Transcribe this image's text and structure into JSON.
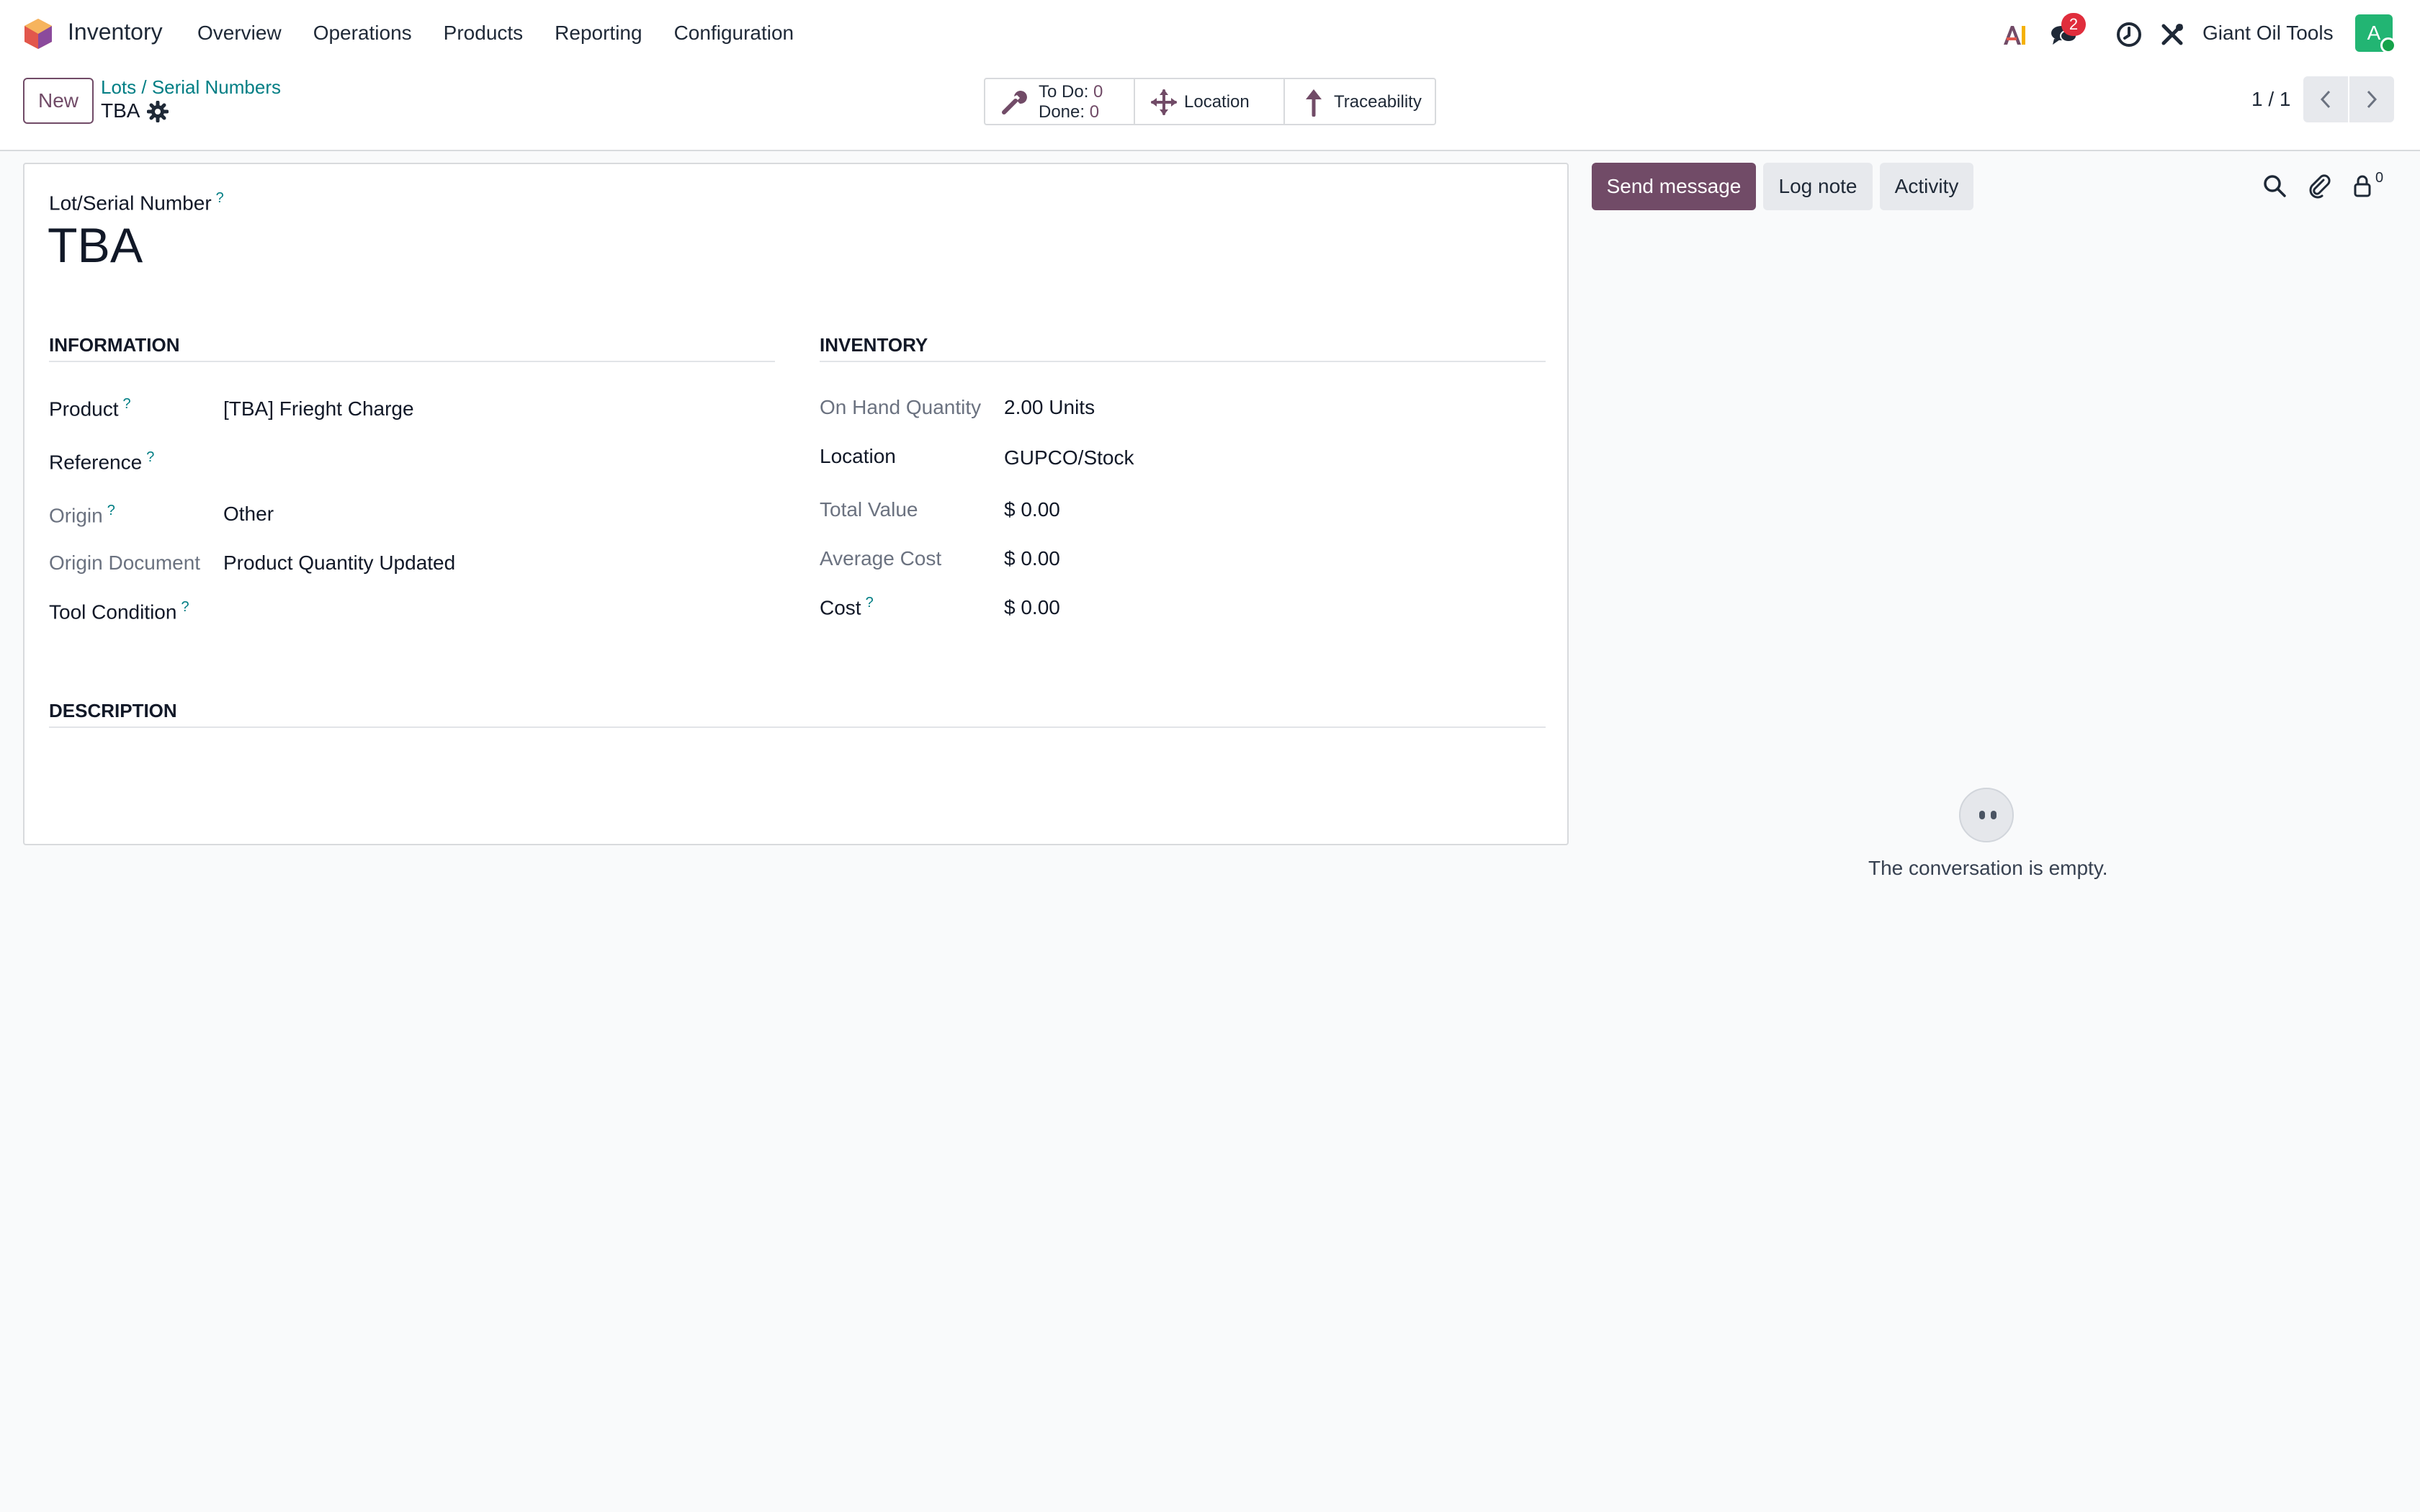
{
  "navbar": {
    "app_name": "Inventory",
    "menu": [
      "Overview",
      "Operations",
      "Products",
      "Reporting",
      "Configuration"
    ],
    "messages_badge": "2",
    "company": "Giant Oil Tools",
    "avatar_initial": "A",
    "icons": [
      "odoo-logo-icon",
      "ai-icon",
      "chat-icon",
      "clock-icon",
      "tools-icon"
    ]
  },
  "control_panel": {
    "new_label": "New",
    "breadcrumb": "Lots / Serial Numbers",
    "record_name": "TBA",
    "smart_buttons": {
      "todo_label": "To Do:",
      "todo_value": "0",
      "done_label": "Done:",
      "done_value": "0",
      "location_label": "Location",
      "traceability_label": "Traceability"
    },
    "pager": "1 / 1"
  },
  "form": {
    "title_label": "Lot/Serial Number",
    "title_value": "TBA",
    "tooltip_mark": "?",
    "information": {
      "heading": "INFORMATION",
      "product_label": "Product",
      "product_value": "[TBA] Frieght Charge",
      "reference_label": "Reference",
      "reference_value": "",
      "origin_label": "Origin",
      "origin_value": "Other",
      "origin_document_label": "Origin Document",
      "origin_document_value": "Product Quantity Updated",
      "tool_condition_label": "Tool Condition",
      "tool_condition_value": ""
    },
    "inventory": {
      "heading": "INVENTORY",
      "on_hand_label": "On Hand Quantity",
      "on_hand_value": "2.00 Units",
      "location_label": "Location",
      "location_value": "GUPCO/Stock",
      "total_value_label": "Total Value",
      "total_value_value": "$ 0.00",
      "average_cost_label": "Average Cost",
      "average_cost_value": "$ 0.00",
      "cost_label": "Cost",
      "cost_value": "$ 0.00"
    },
    "description": {
      "heading": "DESCRIPTION"
    }
  },
  "chatter": {
    "send_message": "Send message",
    "log_note": "Log note",
    "activity": "Activity",
    "follower_count": "0",
    "empty_text": "The conversation is empty."
  },
  "colors": {
    "brand": "#714b67",
    "link": "#017e84",
    "badge": "#e02d3c",
    "avatar": "#22b573"
  }
}
